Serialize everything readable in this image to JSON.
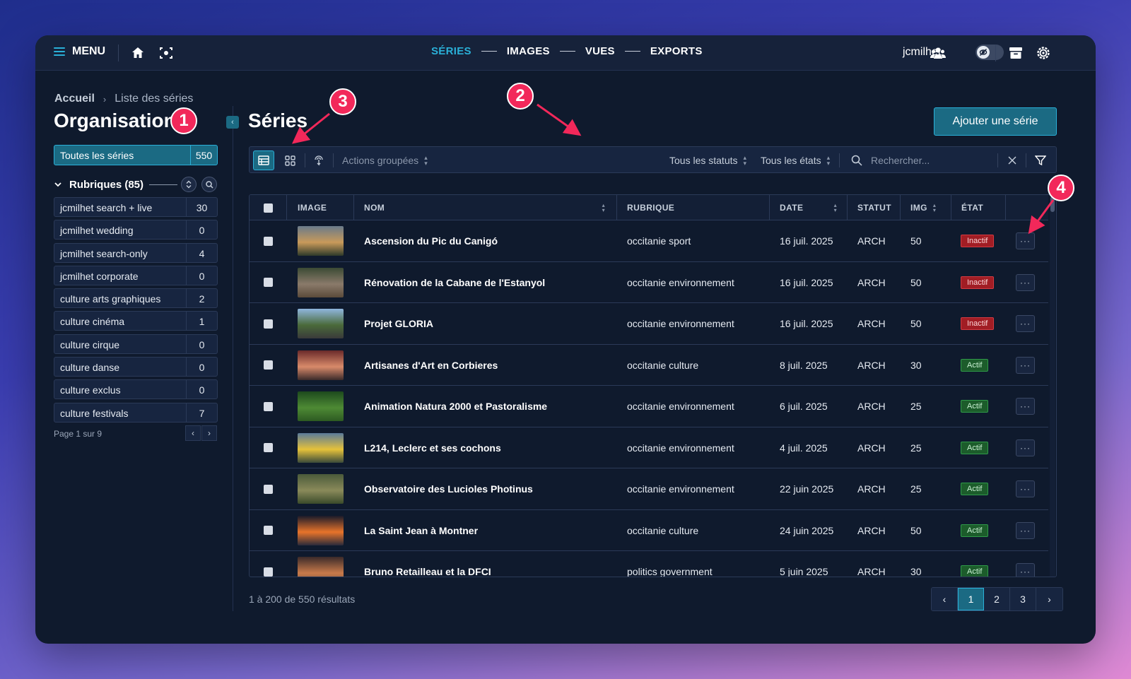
{
  "topbar": {
    "menu_label": "MENU",
    "nav": [
      "SÉRIES",
      "IMAGES",
      "VUES",
      "EXPORTS"
    ],
    "active_nav": "SÉRIES",
    "username": "jcmilhet"
  },
  "sidebar": {
    "breadcrumb": {
      "home": "Accueil",
      "current": "Liste des séries"
    },
    "title": "Organisation",
    "all_series": {
      "label": "Toutes les séries",
      "count": "550"
    },
    "rubriques_label": "Rubriques (85)",
    "items": [
      {
        "label": "jcmilhet search + live",
        "count": "30"
      },
      {
        "label": "jcmilhet wedding",
        "count": "0"
      },
      {
        "label": "jcmilhet search-only",
        "count": "4"
      },
      {
        "label": "jcmilhet corporate",
        "count": "0"
      },
      {
        "label": "culture arts graphiques",
        "count": "2"
      },
      {
        "label": "culture cinéma",
        "count": "1"
      },
      {
        "label": "culture cirque",
        "count": "0"
      },
      {
        "label": "culture danse",
        "count": "0"
      },
      {
        "label": "culture exclus",
        "count": "0"
      },
      {
        "label": "culture festivals",
        "count": "7"
      }
    ],
    "page_info": "Page 1 sur 9"
  },
  "main": {
    "title": "Séries",
    "add_button": "Ajouter une série",
    "toolbar": {
      "bulk_actions": "Actions groupées",
      "status_filter": "Tous les statuts",
      "state_filter": "Tous les états",
      "search_placeholder": "Rechercher..."
    },
    "columns": [
      "IMAGE",
      "NOM",
      "RUBRIQUE",
      "DATE",
      "STATUT",
      "IMG",
      "ÉTAT"
    ],
    "rows": [
      {
        "name": "Ascension du Pic du Canigó",
        "rubrique": "occitanie sport",
        "date": "16 juil. 2025",
        "statut": "ARCH",
        "img": "50",
        "etat": "Inactif"
      },
      {
        "name": "Rénovation de la Cabane de l'Estanyol",
        "rubrique": "occitanie environnement",
        "date": "16 juil. 2025",
        "statut": "ARCH",
        "img": "50",
        "etat": "Inactif"
      },
      {
        "name": "Projet GLORIA",
        "rubrique": "occitanie environnement",
        "date": "16 juil. 2025",
        "statut": "ARCH",
        "img": "50",
        "etat": "Inactif"
      },
      {
        "name": "Artisanes d'Art en Corbieres",
        "rubrique": "occitanie culture",
        "date": "8 juil. 2025",
        "statut": "ARCH",
        "img": "30",
        "etat": "Actif"
      },
      {
        "name": "Animation Natura 2000 et Pastoralisme",
        "rubrique": "occitanie environnement",
        "date": "6 juil. 2025",
        "statut": "ARCH",
        "img": "25",
        "etat": "Actif"
      },
      {
        "name": "L214, Leclerc et ses cochons",
        "rubrique": "occitanie environnement",
        "date": "4 juil. 2025",
        "statut": "ARCH",
        "img": "25",
        "etat": "Actif"
      },
      {
        "name": "Observatoire des Lucioles Photinus",
        "rubrique": "occitanie environnement",
        "date": "22 juin 2025",
        "statut": "ARCH",
        "img": "25",
        "etat": "Actif"
      },
      {
        "name": "La Saint Jean à Montner",
        "rubrique": "occitanie culture",
        "date": "24 juin 2025",
        "statut": "ARCH",
        "img": "50",
        "etat": "Actif"
      },
      {
        "name": "Bruno Retailleau et la DFCI",
        "rubrique": "politics government",
        "date": "5 juin 2025",
        "statut": "ARCH",
        "img": "30",
        "etat": "Actif"
      }
    ],
    "results_text": "1 à 200 de 550 résultats",
    "pages": [
      "1",
      "2",
      "3"
    ],
    "current_page": "1"
  },
  "annotations": [
    "1",
    "2",
    "3",
    "4"
  ],
  "colors": {
    "accent": "#2ab0d8",
    "primary": "#1b6a83",
    "annotation": "#f2285a",
    "inactive": "#a11d24",
    "active": "#1c5c2b"
  },
  "icons": [
    "menu-icon",
    "home-icon",
    "focus-icon",
    "users-icon",
    "eye-off-icon",
    "archive-icon",
    "settings-icon",
    "table-view-icon",
    "grid-view-icon",
    "touch-icon",
    "search-icon",
    "clear-icon",
    "filter-icon",
    "more-icon"
  ]
}
